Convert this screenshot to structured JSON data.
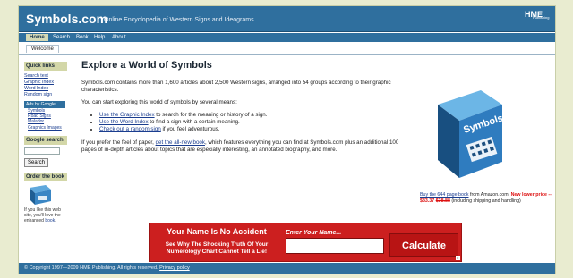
{
  "header": {
    "logo": "Symbols.com",
    "tagline": "Online Encyclopedia of Western Signs and Ideograms",
    "publisher_logo": "HME",
    "publisher_sub": "Publishing"
  },
  "nav": {
    "tabs": [
      "Home",
      "Search",
      "Book",
      "Help",
      "About"
    ],
    "active": "Home",
    "subtab": "Welcome"
  },
  "sidebar": {
    "quick_links_title": "Quick links",
    "quick_links": [
      "Search text",
      "Graphic Index",
      "Word Index",
      "Random sign"
    ],
    "ads_label": "Ads by Google",
    "ad_links": [
      "Symbols",
      "Road Signs",
      "Malador",
      "Graphics Images"
    ],
    "google_search_title": "Google search",
    "search_button": "Search",
    "order_title": "Order the book",
    "order_text_1": "If you like this web site, you'll love the enhanced",
    "order_link": "book"
  },
  "main": {
    "title": "Explore a World of Symbols",
    "intro": "Symbols.com contains more than 1,600 articles about 2,500 Western signs, arranged into 54 groups according to their graphic characteristics.",
    "explore_text": "You can start exploring this world of symbols by several means:",
    "list": [
      {
        "link": "Use the Graphic Index",
        "text": " to search for the meaning or history of a sign."
      },
      {
        "link": "Use the Word Index",
        "text": " to find a sign with a certain meaning."
      },
      {
        "link": "Check out a random sign",
        "text": " if you feel adventurous."
      }
    ],
    "paper_1": "If you prefer the feel of paper, ",
    "paper_link": "get the all-new book",
    "paper_2": ", which features everything you can find at Symbols.com plus an additional 100 pages of in-depth articles about topics that are especially interesting, an annotated biography, and more."
  },
  "book": {
    "cover_title": "Symbols",
    "caption_link": "Buy the 644 page book",
    "caption_text": " from Amazon.com. ",
    "new_price_label": "New lower price -- $33.37",
    "old_price": "$38.88",
    "caption_end": " (including shipping and handling)"
  },
  "ad": {
    "headline": "Your Name Is No Accident",
    "subline": "See Why The Shocking Truth Of Your Numerology Chart Cannot Tell a Lie!",
    "input_label": "Enter Your Name...",
    "button": "Calculate"
  },
  "footer": {
    "copyright": "© Copyright 1997—2009 HME Publishing. All rights reserved. ",
    "privacy": "Privacy policy"
  },
  "colors": {
    "brand_blue": "#2f6f9e",
    "sidebar_head": "#d3d7a8",
    "ad_red": "#cc1f1f",
    "page_bg": "#e9ecd0"
  }
}
